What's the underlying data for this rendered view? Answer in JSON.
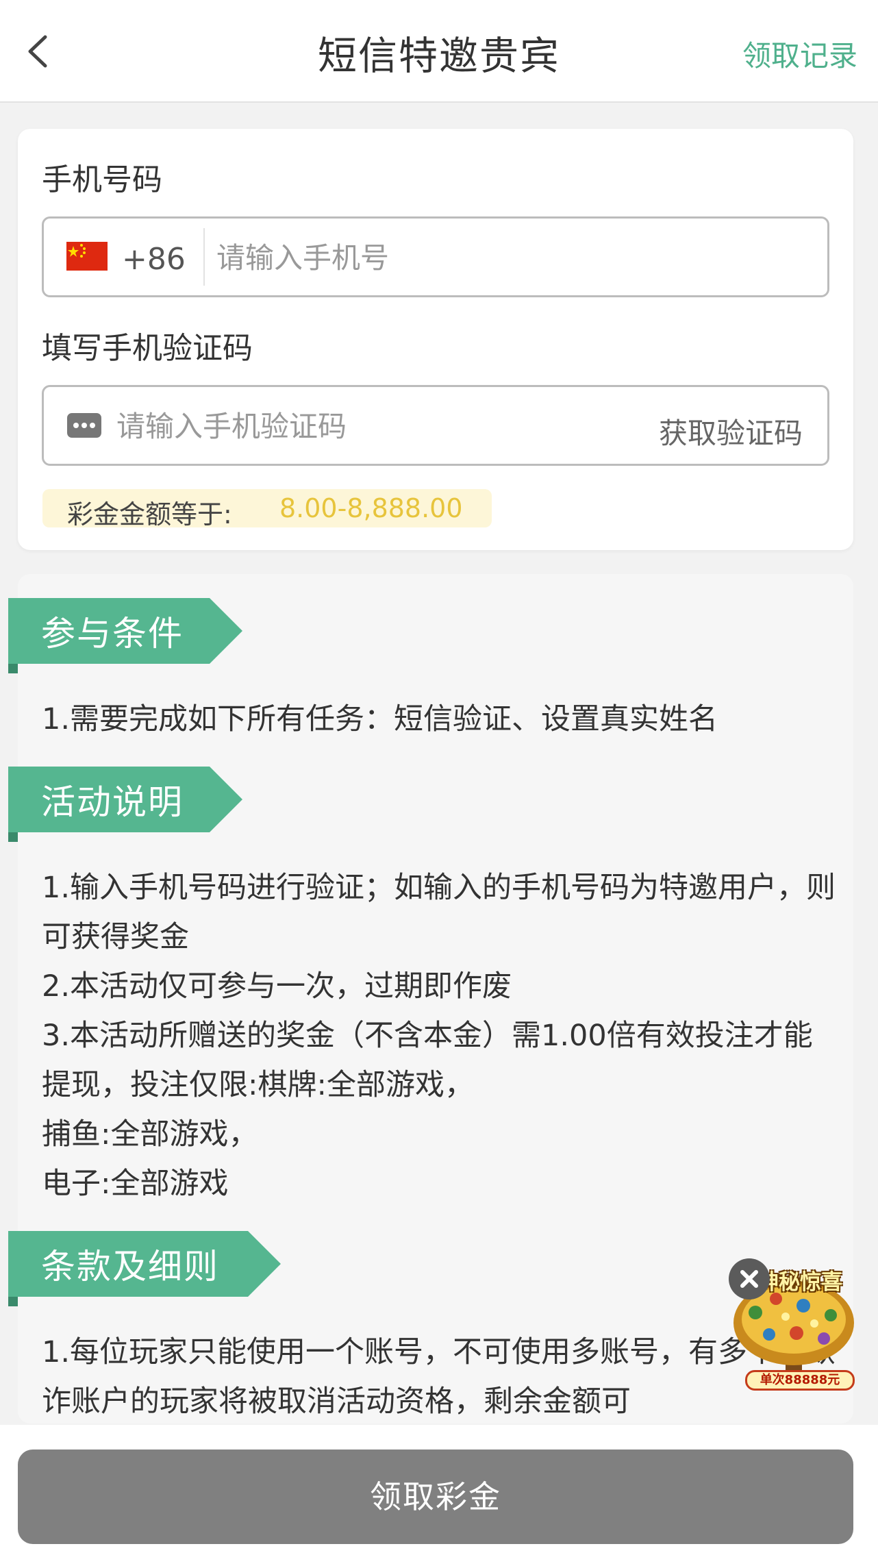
{
  "header": {
    "title": "短信特邀贵宾",
    "records_label": "领取记录"
  },
  "form": {
    "phone_label": "手机号码",
    "dial_code": "+86",
    "phone_placeholder": "请输入手机号",
    "code_label": "填写手机验证码",
    "code_placeholder": "请输入手机验证码",
    "get_code_label": "获取验证码",
    "bonus_label": "彩金金额等于:",
    "bonus_value": "8.00-8,888.00"
  },
  "sections": [
    {
      "title": "参与条件",
      "body": "1.需要完成如下所有任务：短信验证、设置真实姓名"
    },
    {
      "title": "活动说明",
      "body": "1.输入手机号码进行验证；如输入的手机号码为特邀用户，则可获得奖金\n2.本活动仅可参与一次，过期即作废\n3.本活动所赠送的奖金（不含本金）需1.00倍有效投注才能提现，投注仅限:棋牌:全部游戏，\n捕鱼:全部游戏，\n电子:全部游戏"
    },
    {
      "title": "条款及细则",
      "body": "1.每位玩家只能使用一个账号，不可使用多账号，有多个或欺诈账户的玩家将被取消活动资格，剩余金额可"
    }
  ],
  "promo": {
    "title": "神秘惊喜",
    "badge": "单次88888元",
    "close_icon": "close-icon"
  },
  "claim_button": "领取彩金",
  "colors": {
    "accent": "#4fb08c",
    "ribbon": "#55b690",
    "bonus_value": "#e7c43c",
    "button_disabled": "#808080"
  }
}
